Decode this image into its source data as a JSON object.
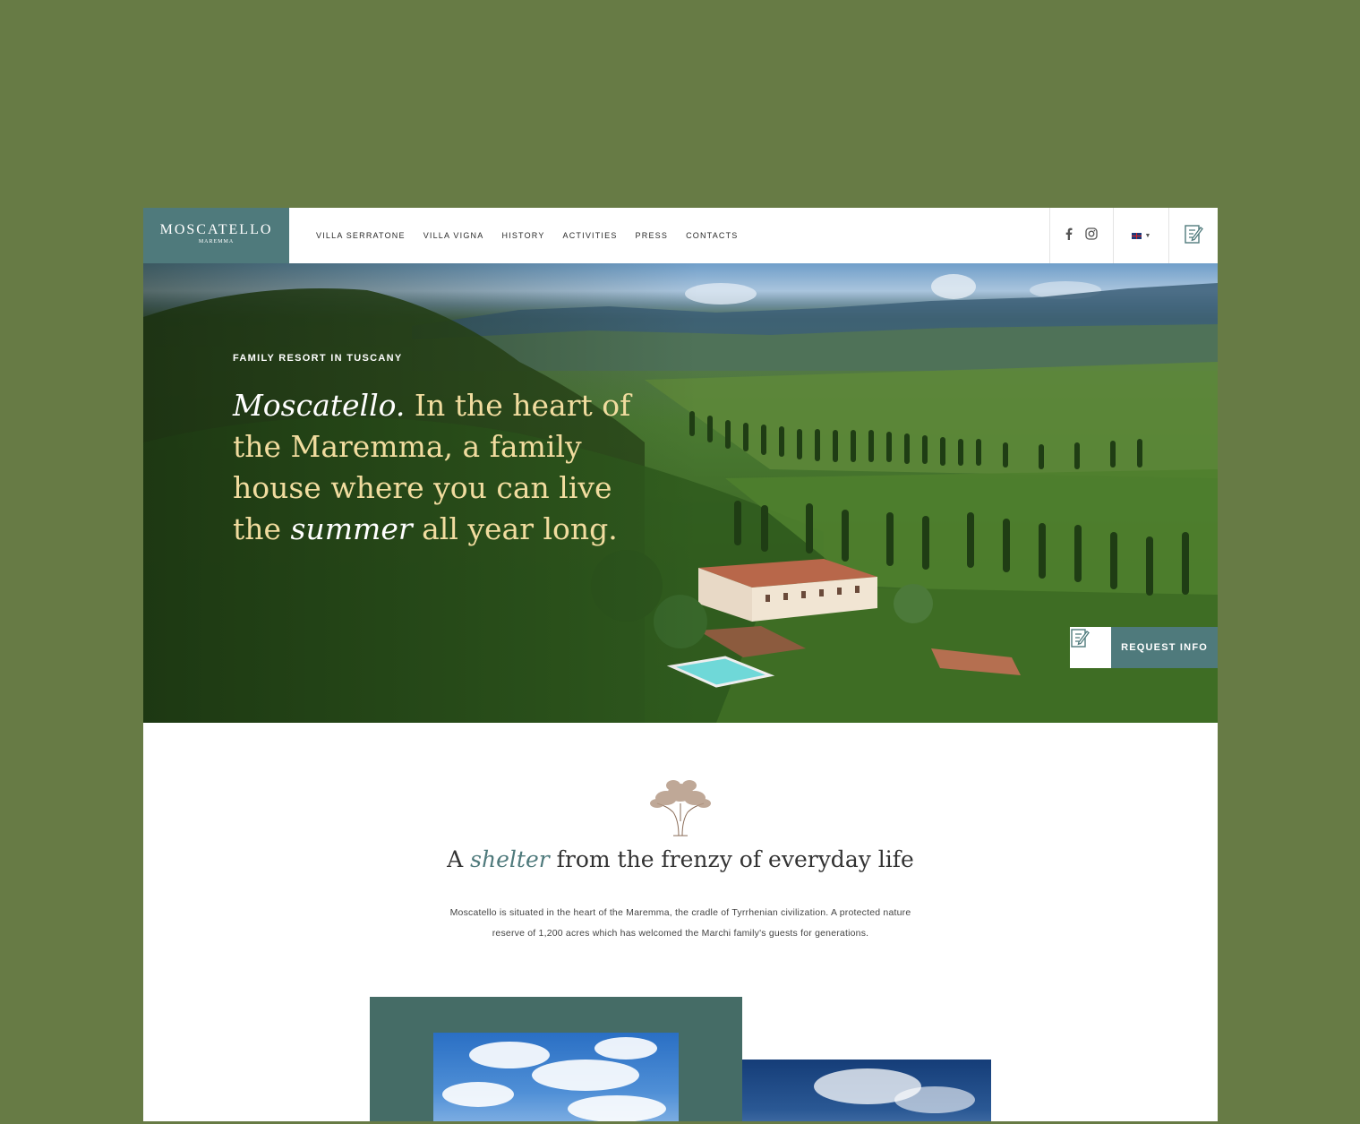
{
  "header": {
    "logo_name": "MOSCATELLO",
    "logo_sub": "MAREMMA",
    "nav": [
      "VILLA SERRATONE",
      "VILLA VIGNA",
      "HISTORY",
      "ACTIVITIES",
      "PRESS",
      "CONTACTS"
    ],
    "social_icons": [
      "facebook-icon",
      "instagram-icon"
    ],
    "language": "uk-flag",
    "edit_icon": "edit-note-icon"
  },
  "hero": {
    "kicker": "FAMILY RESORT IN TUSCANY",
    "headline_part1": "Moscatello.",
    "headline_part2": " In the heart of the Maremma, a family house where you can live the ",
    "headline_part3": "summer",
    "headline_part4": " all year long.",
    "request_label": "REQUEST INFO"
  },
  "intro": {
    "title_part1": "A ",
    "title_part2": "shelter",
    "title_part3": " from the frenzy of everyday life",
    "text": "Moscatello is situated in the heart of the Maremma, the cradle of Tyrrhenian civilization. A protected nature reserve of 1,200 acres which has welcomed the Marchi family's guests for generations."
  },
  "colors": {
    "page_bg": "#677b45",
    "brand_teal": "#4f7a7c",
    "headline_gold": "#f1dc9f"
  }
}
